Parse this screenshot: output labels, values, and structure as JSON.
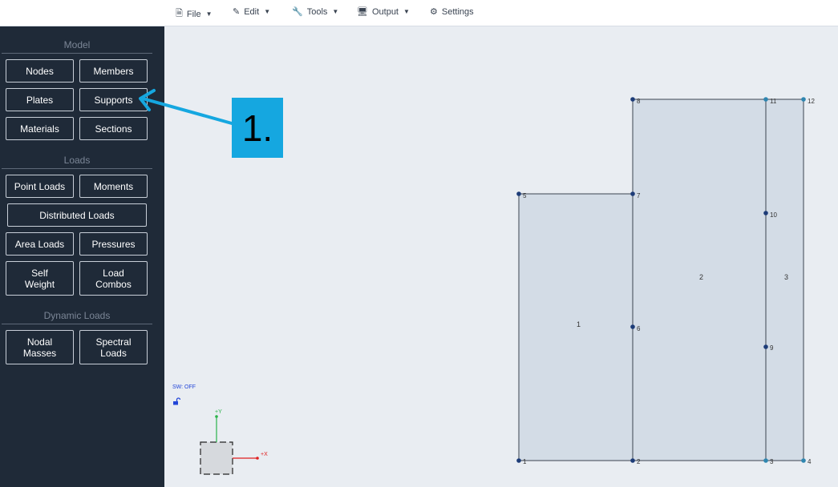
{
  "menu": {
    "file": "File",
    "edit": "Edit",
    "tools": "Tools",
    "output": "Output",
    "settings": "Settings"
  },
  "sidebar": {
    "model_title": "Model",
    "loads_title": "Loads",
    "dynamic_title": "Dynamic Loads",
    "nodes": "Nodes",
    "members": "Members",
    "plates": "Plates",
    "supports": "Supports",
    "materials": "Materials",
    "sections": "Sections",
    "point_loads": "Point Loads",
    "moments": "Moments",
    "distributed_loads": "Distributed Loads",
    "area_loads": "Area Loads",
    "pressures": "Pressures",
    "self_weight_1": "Self",
    "self_weight_2": "Weight",
    "load_combos_1": "Load",
    "load_combos_2": "Combos",
    "nodal_masses_1": "Nodal",
    "nodal_masses_2": "Masses",
    "spectral_loads_1": "Spectral",
    "spectral_loads_2": "Loads"
  },
  "canvas": {
    "sw_status": "SW: OFF",
    "axis_y": "+Y",
    "axis_x": "+X",
    "plates": [
      "1",
      "2",
      "3"
    ],
    "nodes": [
      "1",
      "2",
      "3",
      "4",
      "5",
      "6",
      "7",
      "8",
      "9",
      "10",
      "11",
      "12"
    ]
  },
  "annotation": {
    "label": "1."
  },
  "colors": {
    "sidebar_bg": "#1f2a38",
    "canvas_bg": "#e9edf2",
    "plate_fill": "#d3dce6",
    "node_dark": "#1d3c78",
    "node_light": "#2f86b0",
    "annotation": "#15a7e0"
  }
}
